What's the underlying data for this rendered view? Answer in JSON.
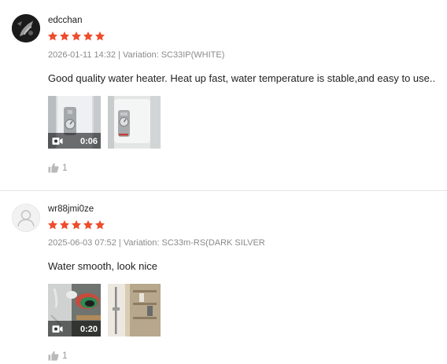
{
  "colors": {
    "star": "#ee4d2d",
    "meta": "#8a8a8a",
    "divider": "#e5e5e5"
  },
  "reviews": [
    {
      "username": "edcchan",
      "rating": 5,
      "meta": "2026-01-11 14:32 | Variation: SC33IP(WHITE)",
      "text": "Good quality water heater. Heat up fast, water temperature is stable,and easy to use..",
      "media": [
        {
          "type": "video",
          "duration": "0:06",
          "icon": "video-camera-icon"
        },
        {
          "type": "image"
        }
      ],
      "likes": "1"
    },
    {
      "username": "wr88jmi0ze",
      "rating": 5,
      "meta": "2025-06-03 07:52 | Variation: SC33m-RS(DARK SILVER",
      "text": "Water smooth, look nice",
      "media": [
        {
          "type": "video",
          "duration": "0:20",
          "icon": "video-camera-icon"
        },
        {
          "type": "image"
        }
      ],
      "likes": "1"
    }
  ]
}
